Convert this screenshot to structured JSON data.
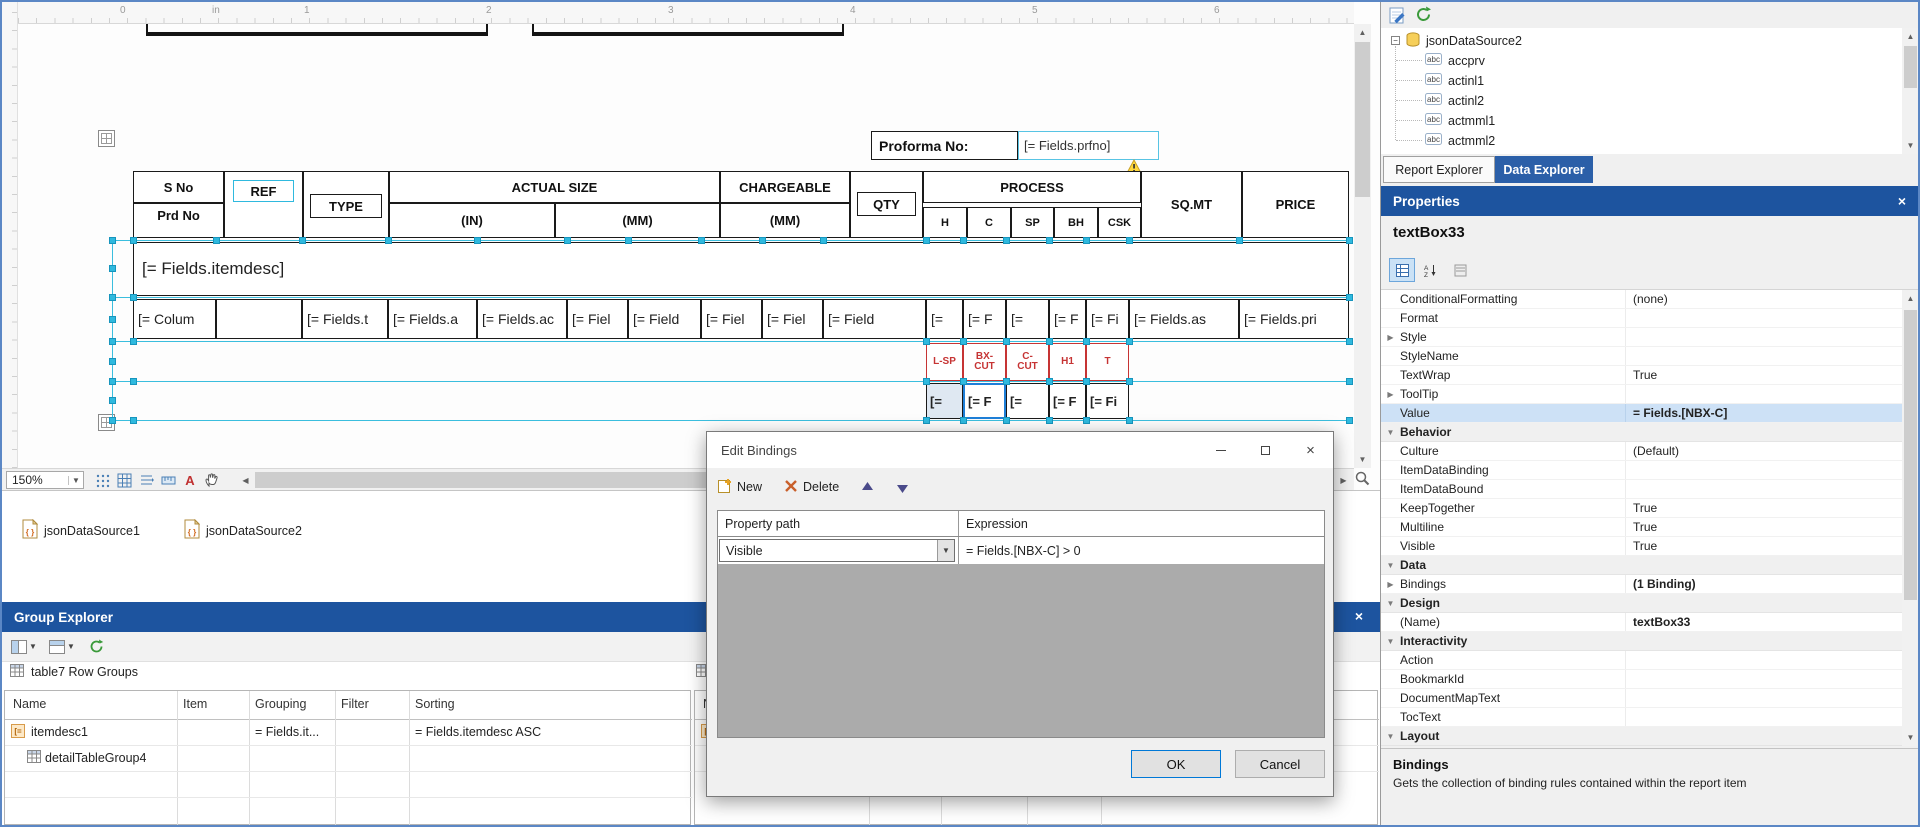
{
  "design": {
    "ruler": [
      "0",
      "in",
      "1",
      "2",
      "3",
      "4",
      "5",
      "6"
    ],
    "proforma_label": "Proforma No:",
    "proforma_value": "[= Fields.prfno]",
    "header": {
      "s_no": "S No",
      "prd_no": "Prd No",
      "ref": "REF",
      "type": "TYPE",
      "actual_size": "ACTUAL SIZE",
      "size_in": "(IN)",
      "size_mm": "(MM)",
      "chargeable": "CHARGEABLE",
      "chargeable_mm": "(MM)",
      "qty": "QTY",
      "process": "PROCESS",
      "process_cols": [
        "H",
        "C",
        "SP",
        "BH",
        "CSK"
      ],
      "sq_mt": "SQ.MT",
      "price": "PRICE"
    },
    "itemdesc": "[= Fields.itemdesc]",
    "detail_cells": [
      "[= Colum",
      "",
      "[= Fields.t",
      "[= Fields.a",
      "[= Fields.ac",
      "[= Fiel",
      "[= Field",
      "[= Fiel",
      "[= Fiel",
      "[= Field",
      "[=",
      "[= F",
      "[=",
      "[= F",
      "[= Fi",
      "[= Fields.as",
      "[= Fields.pri"
    ],
    "red_cells": [
      "L-SP",
      "BX-CUT",
      "C-CUT",
      "H1",
      "T"
    ],
    "sel_cells": [
      "[=",
      "[= F",
      "[=",
      "[= F",
      "[= Fi"
    ],
    "zoom": "150%"
  },
  "datasources": [
    "jsonDataSource1",
    "jsonDataSource2"
  ],
  "group_explorer": {
    "title": "Group Explorer",
    "caption": "table7 Row Groups",
    "columns": [
      "Name",
      "Item",
      "Grouping",
      "Filter",
      "Sorting"
    ],
    "rows": [
      {
        "name": "itemdesc1",
        "grouping": "= Fields.it...",
        "sorting": "= Fields.itemdesc ASC"
      },
      {
        "name": "detailTableGroup4",
        "grouping": "",
        "sorting": ""
      }
    ]
  },
  "dialog": {
    "title": "Edit Bindings",
    "new_label": "New",
    "delete_label": "Delete",
    "col_property": "Property path",
    "col_expression": "Expression",
    "row_property": "Visible",
    "row_expression": "= Fields.[NBX-C] > 0",
    "ok": "OK",
    "cancel": "Cancel"
  },
  "data_explorer": {
    "root": "jsonDataSource2",
    "fields": [
      "accprv",
      "actinl1",
      "actinl2",
      "actmml1",
      "actmml2"
    ],
    "tab_report": "Report Explorer",
    "tab_data": "Data Explorer"
  },
  "properties": {
    "title": "Properties",
    "object_name": "textBox33",
    "rows": [
      {
        "l": "ConditionalFormatting",
        "v": "(none)"
      },
      {
        "l": "Format",
        "v": ""
      },
      {
        "l": "Style",
        "v": ""
      },
      {
        "l": "StyleName",
        "v": ""
      },
      {
        "l": "TextWrap",
        "v": "True"
      },
      {
        "l": "ToolTip",
        "v": ""
      },
      {
        "l": "Value",
        "v": "= Fields.[NBX-C]"
      },
      {
        "l": "Behavior",
        "v": ""
      },
      {
        "l": "Culture",
        "v": "(Default)"
      },
      {
        "l": "ItemDataBinding",
        "v": ""
      },
      {
        "l": "ItemDataBound",
        "v": ""
      },
      {
        "l": "KeepTogether",
        "v": "True"
      },
      {
        "l": "Multiline",
        "v": "True"
      },
      {
        "l": "Visible",
        "v": "True"
      },
      {
        "l": "Data",
        "v": ""
      },
      {
        "l": "Bindings",
        "v": "(1 Binding)"
      },
      {
        "l": "Design",
        "v": ""
      },
      {
        "l": "(Name)",
        "v": "textBox33"
      },
      {
        "l": "Interactivity",
        "v": ""
      },
      {
        "l": "Action",
        "v": ""
      },
      {
        "l": "BookmarkId",
        "v": ""
      },
      {
        "l": "DocumentMapText",
        "v": ""
      },
      {
        "l": "TocText",
        "v": ""
      },
      {
        "l": "Layout",
        "v": ""
      }
    ],
    "desc_title": "Bindings",
    "desc_text": "Gets the collection of binding rules contained within the report item"
  },
  "colors": {
    "titlebar": "#1d549f",
    "active_tab": "#2b5fa8",
    "adorner": "#2fb9de",
    "selection": "#1e7fd8",
    "red_cells": "#c63434"
  }
}
